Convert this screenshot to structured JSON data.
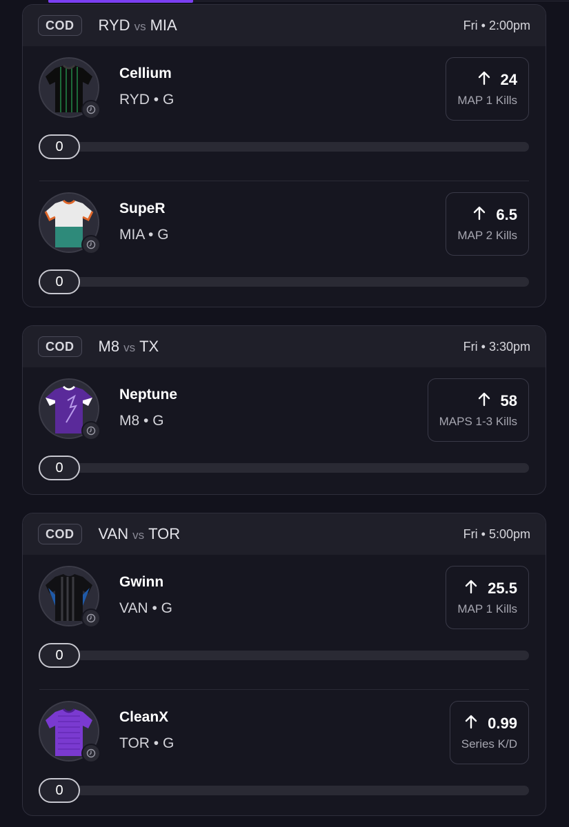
{
  "colors": {
    "background": "#12121c",
    "card": "#161620",
    "card_header": "#1f1f29",
    "accent": "#7b3ff2",
    "track": "#2a2a34"
  },
  "cards": [
    {
      "league": "COD",
      "team_a": "RYD",
      "vs": "vs",
      "team_b": "MIA",
      "time": "Fri • 2:00pm",
      "players": [
        {
          "name": "Cellium",
          "team_pos": "RYD • G",
          "line": "24",
          "stat": "MAP 1 Kills",
          "progress_value": "0",
          "progress_fraction": 0,
          "jersey": "ryd-jersey-icon"
        },
        {
          "name": "SupeR",
          "team_pos": "MIA • G",
          "line": "6.5",
          "stat": "MAP 2 Kills",
          "progress_value": "0",
          "progress_fraction": 0,
          "jersey": "mia-jersey-icon"
        }
      ]
    },
    {
      "league": "COD",
      "team_a": "M8",
      "vs": "vs",
      "team_b": "TX",
      "time": "Fri • 3:30pm",
      "players": [
        {
          "name": "Neptune",
          "team_pos": "M8 • G",
          "line": "58",
          "stat": "MAPS 1-3 Kills",
          "progress_value": "0",
          "progress_fraction": 0,
          "jersey": "m8-jersey-icon"
        }
      ]
    },
    {
      "league": "COD",
      "team_a": "VAN",
      "vs": "vs",
      "team_b": "TOR",
      "time": "Fri • 5:00pm",
      "players": [
        {
          "name": "Gwinn",
          "team_pos": "VAN • G",
          "line": "25.5",
          "stat": "MAP 1 Kills",
          "progress_value": "0",
          "progress_fraction": 0,
          "jersey": "van-jersey-icon"
        },
        {
          "name": "CleanX",
          "team_pos": "TOR • G",
          "line": "0.99",
          "stat": "Series K/D",
          "progress_value": "0",
          "progress_fraction": 0,
          "jersey": "tor-jersey-icon"
        }
      ]
    }
  ]
}
